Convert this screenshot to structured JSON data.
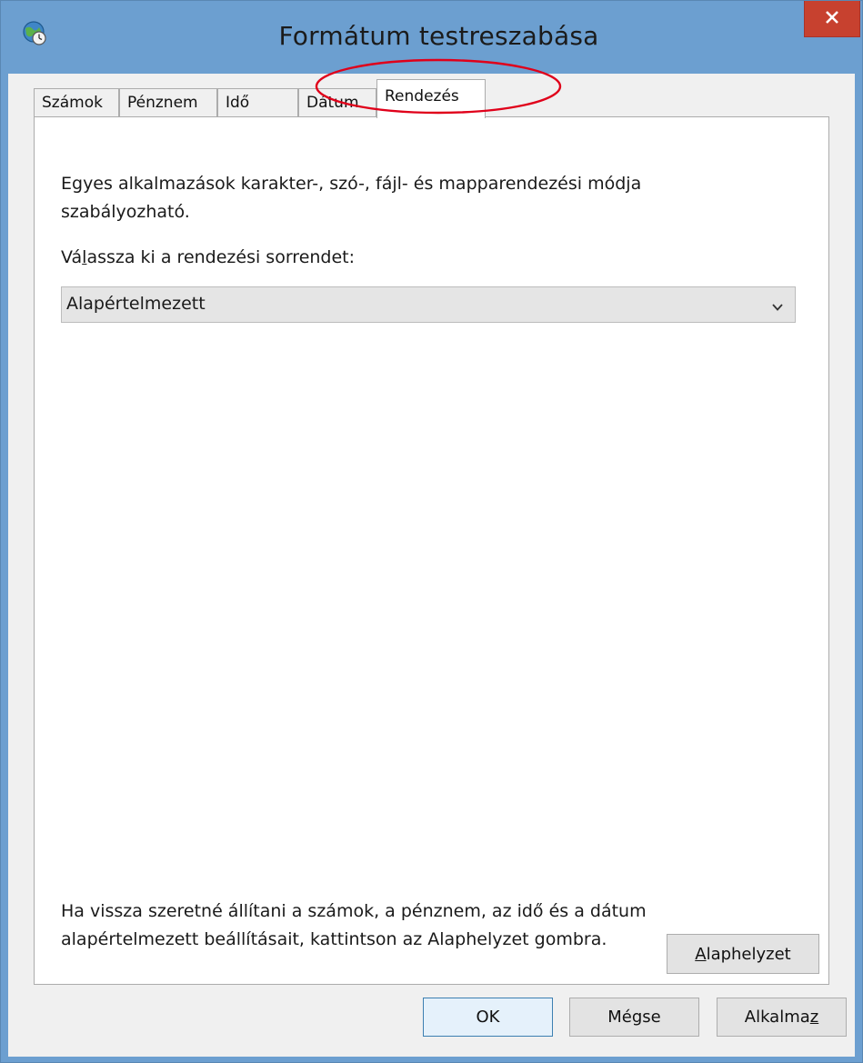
{
  "window": {
    "title": "Formátum testreszabása",
    "close_glyph": "✕",
    "icon": "globe-clock-icon"
  },
  "tabs": [
    {
      "label": "Számok",
      "active": false
    },
    {
      "label": "Pénznem",
      "active": false
    },
    {
      "label": "Idő",
      "active": false
    },
    {
      "label": "Dátum",
      "active": false
    },
    {
      "label": "Rendezés",
      "active": true
    }
  ],
  "sorting": {
    "description": "Egyes alkalmazások karakter-, szó-, fájl- és mapparendezési módja szabályozható.",
    "label_prefix": "Vá",
    "label_accel": "l",
    "label_suffix": "assza ki a rendezési sorrendet:",
    "selected": "Alapértelmezett"
  },
  "reset": {
    "text": "Ha vissza szeretné állítani a számok, a pénznem, az idő és a dátum alapértelmezett beállításait, kattintson az Alaphelyzet gombra.",
    "button_accel": "A",
    "button_rest": "laphelyzet"
  },
  "footer": {
    "ok": "OK",
    "cancel": "Mégse",
    "apply_prefix": "Alkalma",
    "apply_accel": "z"
  },
  "colors": {
    "titlebar": "#6c9fd0",
    "close": "#c7412f",
    "annotation": "#e0001a"
  }
}
